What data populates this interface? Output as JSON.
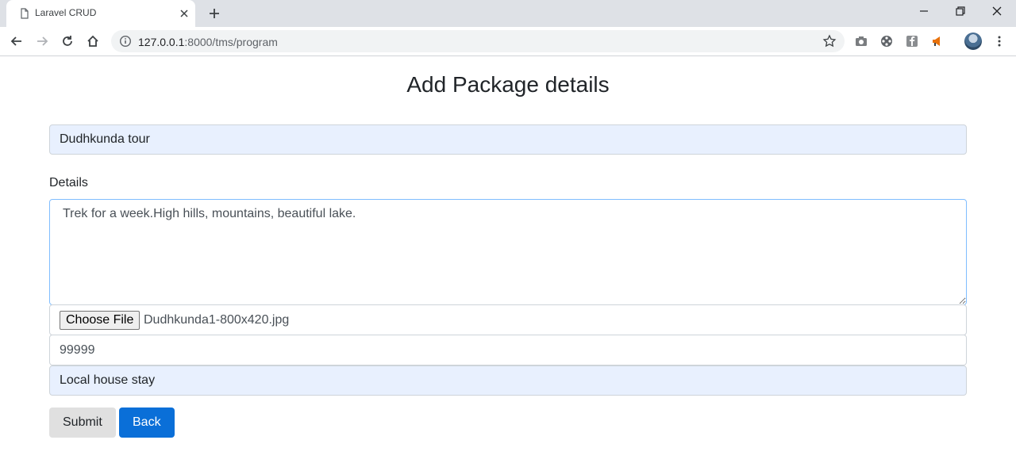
{
  "browser": {
    "tab_title": "Laravel CRUD",
    "url_host": "127.0.0.1",
    "url_rest": ":8000/tms/program"
  },
  "form": {
    "title": "Add Package details",
    "name_value": "Dudhkunda tour",
    "details_label": "Details",
    "details_value": "Trek for a week.High hills, mountains, beautiful lake.",
    "file_button_label": "Choose File",
    "file_name": "Dudhkunda1-800x420.jpg",
    "price_value": "99999",
    "stay_value": "Local house stay",
    "submit_label": "Submit",
    "back_label": "Back"
  },
  "colors": {
    "autofill_bg": "#e8f0fe",
    "primary": "#0a6fd8",
    "focus_border": "#80bdff"
  }
}
